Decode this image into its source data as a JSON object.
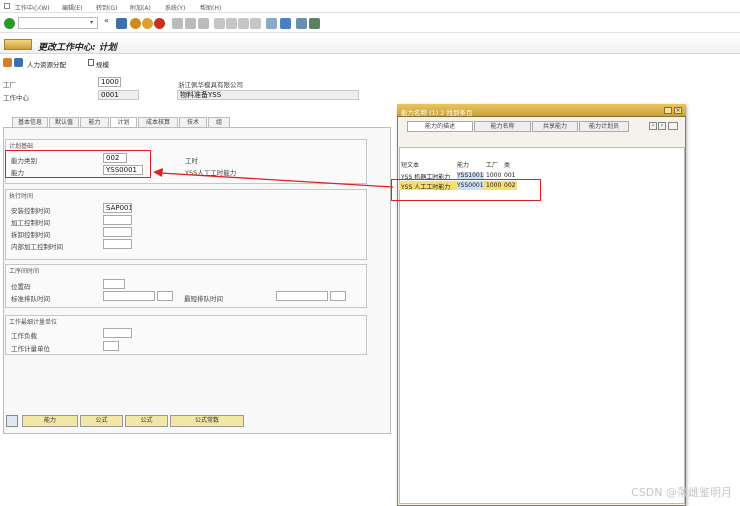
{
  "menu": {
    "items": [
      "工作中心(W)",
      "编辑(E)",
      "转到(G)",
      "附加(A)",
      "系统(Y)",
      "帮助(H)"
    ]
  },
  "header": {
    "title": "更改工作中心: 计划"
  },
  "appbar": {
    "cap_label": "人力资源分配",
    "sample_label": "规模"
  },
  "fields": {
    "plant_label": "工厂",
    "plant_value": "1000",
    "plant_desc": "浙江佩华模具有限公司",
    "wc_label": "工作中心",
    "wc_value": "0001",
    "wc_desc": "物料准备YSS"
  },
  "tabs": [
    "基本信息",
    "默认值",
    "能力",
    "计划",
    "成本核算",
    "技术",
    "组"
  ],
  "panel": {
    "g1_title": "计划基础",
    "cap_cat_label": "能力类别",
    "cap_cat_value": "002",
    "cap_label": "能力",
    "cap_value": "YSS0001",
    "right_label1": "工时",
    "right_label2": "YSS人工工时能力",
    "g2_title": "执行时间",
    "sched_label": "安装控制时间",
    "sched_value": "SAP001",
    "proc_label": "加工控制时间",
    "teardown_label": "拆卸控制时间",
    "internal_label": "内部加工控制时间",
    "g3_title": "工序间时间",
    "queue_label": "位置码",
    "std_queue_label": "标准排队时间",
    "min_queue_label": "最短排队时间",
    "g4_title": "工作最细计量单位",
    "wc_unit_label": "工作负载",
    "unit_label": "工作计量单位"
  },
  "buttons": {
    "capacity": "能力",
    "formula1": "公式",
    "formula2": "公式",
    "formula_const": "公式常数"
  },
  "popup": {
    "title": "能力名称 (1) 2 找到条目",
    "tabs": [
      "能力的描述",
      "能力名称",
      "共享能力",
      "能力计划员"
    ],
    "headers": {
      "text": "短文本",
      "cap": "能力",
      "plant": "工厂",
      "cat": "类"
    },
    "rows": [
      {
        "text": "YSS 机器工时能力",
        "cap": "YSS1001",
        "plant": "1000",
        "cat": "001"
      },
      {
        "text": "YSS 人工工时能力",
        "cap": "YSS0001",
        "plant": "1000",
        "cat": "002"
      }
    ]
  },
  "watermark": "CSDN @薄雌鉴明月",
  "colors": {
    "accent": "#e02020",
    "tab_active": "#ffffff",
    "popup_bar": "#d4ae48",
    "button_yellow": "#f3e7a6"
  }
}
